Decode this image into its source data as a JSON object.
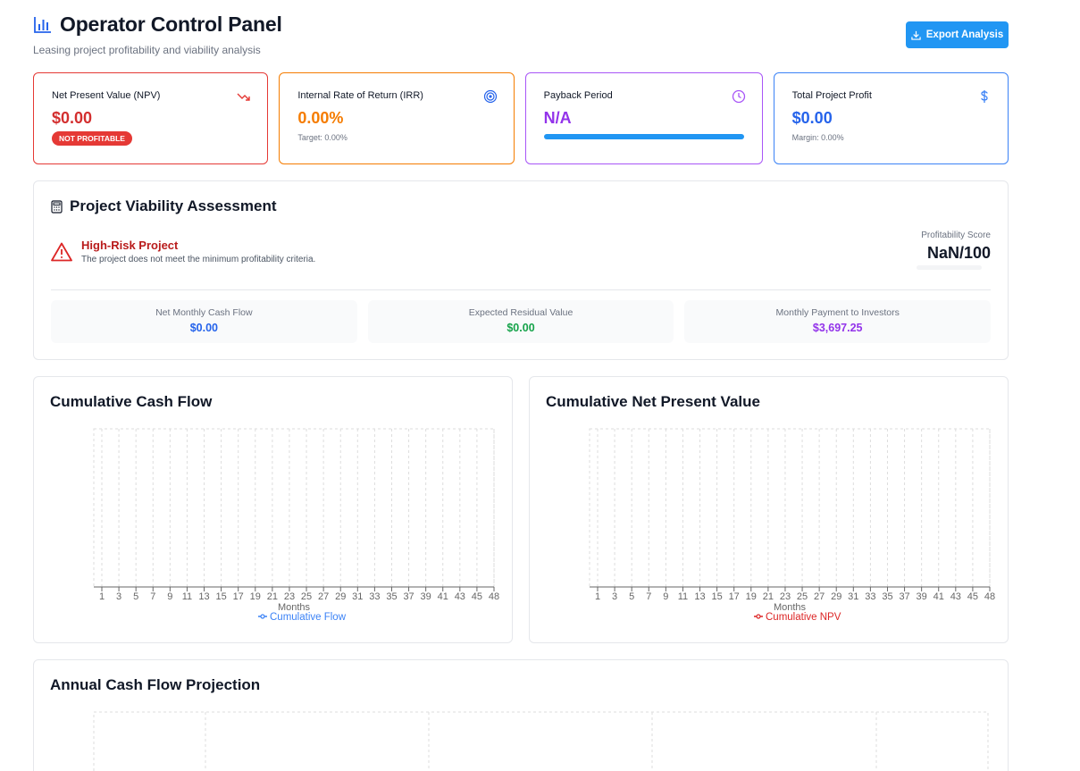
{
  "header": {
    "title": "Operator Control Panel",
    "subtitle": "Leasing project profitability and viability analysis",
    "export_label": "Export Analysis"
  },
  "kpis": {
    "npv": {
      "label": "Net Present Value (NPV)",
      "value": "$0.00",
      "badge": "NOT PROFITABLE",
      "icon": "trending-down-icon",
      "color": "#d32f2f"
    },
    "irr": {
      "label": "Internal Rate of Return (IRR)",
      "value": "0.00%",
      "sub": "Target: 0.00%",
      "icon": "target-icon",
      "color": "#f57c00"
    },
    "payback": {
      "label": "Payback Period",
      "value": "N/A",
      "icon": "clock-icon",
      "color": "#9333ea",
      "progress": 1.0
    },
    "profit": {
      "label": "Total Project Profit",
      "value": "$0.00",
      "sub": "Margin: 0.00%",
      "icon": "dollar-icon",
      "color": "#2563eb"
    }
  },
  "viability": {
    "title": "Project Viability Assessment",
    "risk_title": "High-Risk Project",
    "risk_desc": "The project does not meet the minimum profitability criteria.",
    "score_label": "Profitability Score",
    "score_value": "NaN/100",
    "metrics": [
      {
        "label": "Net Monthly Cash Flow",
        "value": "$0.00",
        "color": "#2563eb"
      },
      {
        "label": "Expected Residual Value",
        "value": "$0.00",
        "color": "#16a34a"
      },
      {
        "label": "Monthly Payment to Investors",
        "value": "$3,697.25",
        "color": "#9333ea"
      }
    ]
  },
  "charts": {
    "cumulative_cash_flow": {
      "title": "Cumulative Cash Flow"
    },
    "cumulative_npv": {
      "title": "Cumulative Net Present Value"
    },
    "annual": {
      "title": "Annual Cash Flow Projection"
    }
  },
  "chart_data": [
    {
      "type": "line",
      "title": "Cumulative Cash Flow",
      "xlabel": "Months",
      "ylabel": "",
      "x_ticks": [
        "1",
        "3",
        "5",
        "7",
        "9",
        "11",
        "13",
        "15",
        "17",
        "19",
        "21",
        "23",
        "25",
        "27",
        "29",
        "31",
        "33",
        "35",
        "37",
        "39",
        "41",
        "43",
        "45",
        "48"
      ],
      "series": [
        {
          "name": "Cumulative Flow",
          "values": [],
          "color": "#3b82f6"
        }
      ],
      "grid": true,
      "legend": "bottom"
    },
    {
      "type": "line",
      "title": "Cumulative Net Present Value",
      "xlabel": "Months",
      "ylabel": "",
      "x_ticks": [
        "1",
        "3",
        "5",
        "7",
        "9",
        "11",
        "13",
        "15",
        "17",
        "19",
        "21",
        "23",
        "25",
        "27",
        "29",
        "31",
        "33",
        "35",
        "37",
        "39",
        "41",
        "43",
        "45",
        "48"
      ],
      "series": [
        {
          "name": "Cumulative NPV",
          "values": [],
          "color": "#dc2626"
        }
      ],
      "grid": true,
      "legend": "bottom"
    },
    {
      "type": "bar",
      "title": "Annual Cash Flow Projection",
      "series": [],
      "grid": true
    }
  ]
}
